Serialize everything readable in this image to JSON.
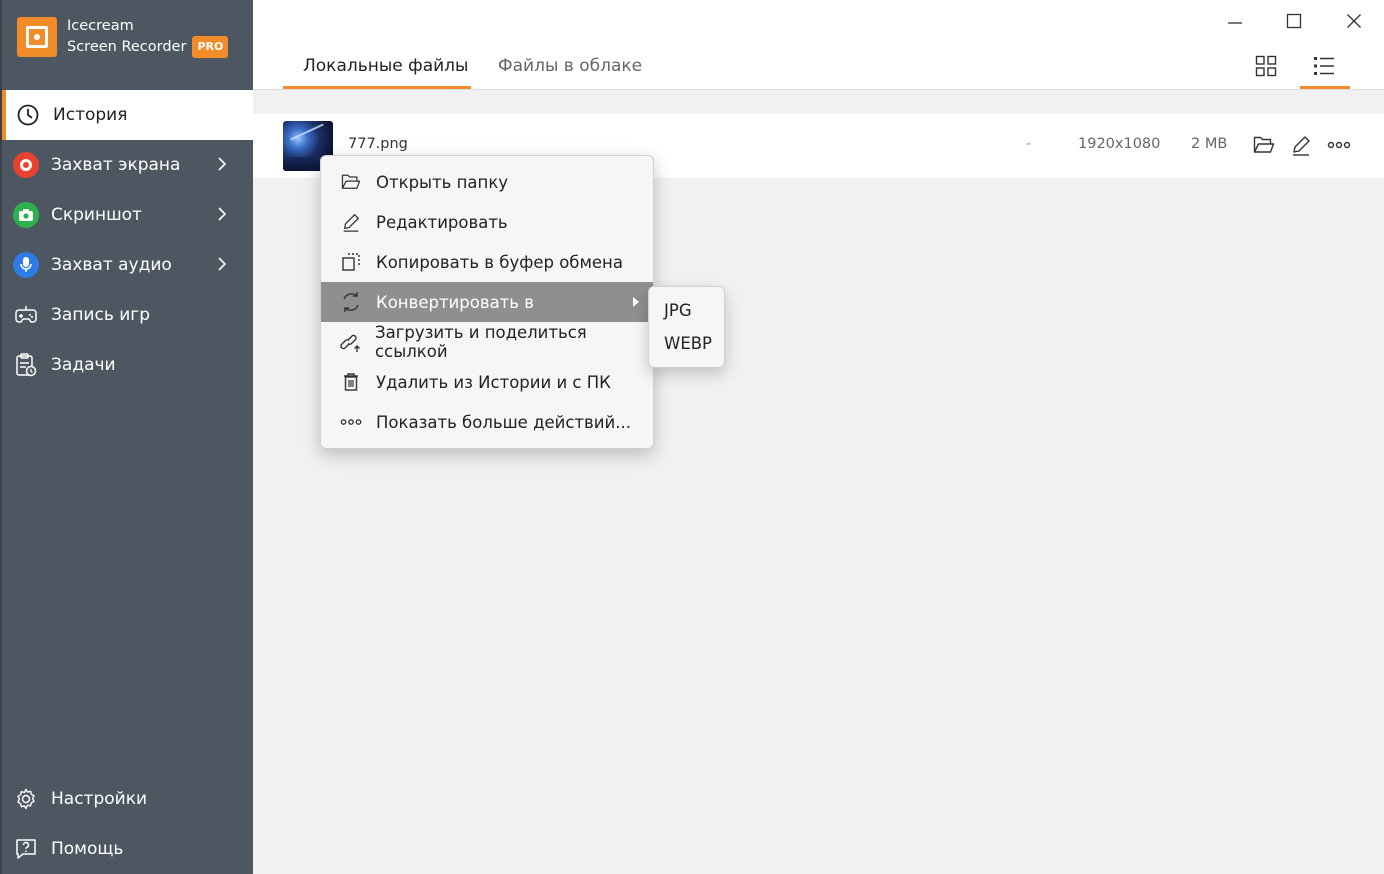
{
  "app": {
    "name_line1": "Icecream",
    "name_line2": "Screen Recorder",
    "badge": "PRO",
    "accent_color": "#f28c28",
    "sidebar_color": "#4d5761"
  },
  "sidebar": {
    "items": [
      {
        "label": "История",
        "icon": "clock-icon",
        "active": true
      },
      {
        "label": "Захват экрана",
        "icon": "record-icon",
        "has_submenu": true,
        "color": "#e8412e"
      },
      {
        "label": "Скриншот",
        "icon": "camera-icon",
        "has_submenu": true,
        "color": "#2bb24c"
      },
      {
        "label": "Захват аудио",
        "icon": "microphone-icon",
        "has_submenu": true,
        "color": "#2f7be5"
      },
      {
        "label": "Запись игр",
        "icon": "gamepad-icon"
      },
      {
        "label": "Задачи",
        "icon": "tasks-icon"
      }
    ],
    "bottom": [
      {
        "label": "Настройки",
        "icon": "gear-icon"
      },
      {
        "label": "Помощь",
        "icon": "help-icon"
      }
    ]
  },
  "tabs": [
    {
      "label": "Локальные файлы",
      "active": true
    },
    {
      "label": "Файлы в облаке",
      "active": false
    }
  ],
  "file": {
    "name": "777.png",
    "duration": "-",
    "resolution": "1920x1080",
    "size": "2 MB"
  },
  "context_menu": {
    "items": [
      {
        "label": "Открыть папку",
        "icon": "folder-icon"
      },
      {
        "label": "Редактировать",
        "icon": "pencil-icon"
      },
      {
        "label": "Копировать в буфер обмена",
        "icon": "copy-icon"
      },
      {
        "label": "Конвертировать в",
        "icon": "convert-icon",
        "highlighted": true,
        "has_submenu": true
      },
      {
        "label": "Загрузить и поделиться ссылкой",
        "icon": "upload-link-icon"
      },
      {
        "label": "Удалить из Истории и с ПК",
        "icon": "trash-icon"
      },
      {
        "label": "Показать больше действий...",
        "icon": "more-icon"
      }
    ],
    "submenu": [
      "JPG",
      "WEBP"
    ]
  }
}
